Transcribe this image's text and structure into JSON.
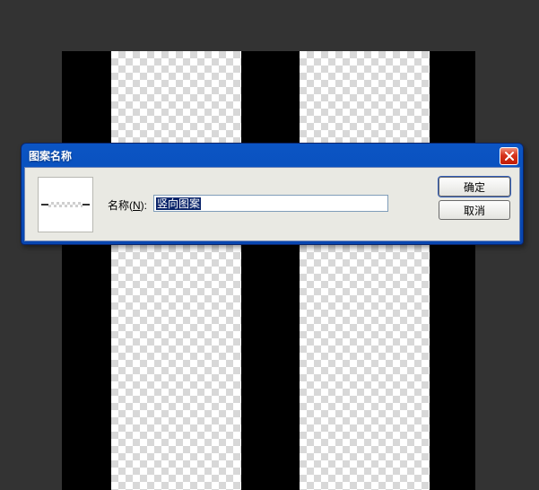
{
  "dialog": {
    "title": "图案名称",
    "name_label_prefix": "名称(",
    "name_label_hotkey": "N",
    "name_label_suffix": "):",
    "name_value": "竖向图案",
    "ok_label": "确定",
    "cancel_label": "取消"
  }
}
